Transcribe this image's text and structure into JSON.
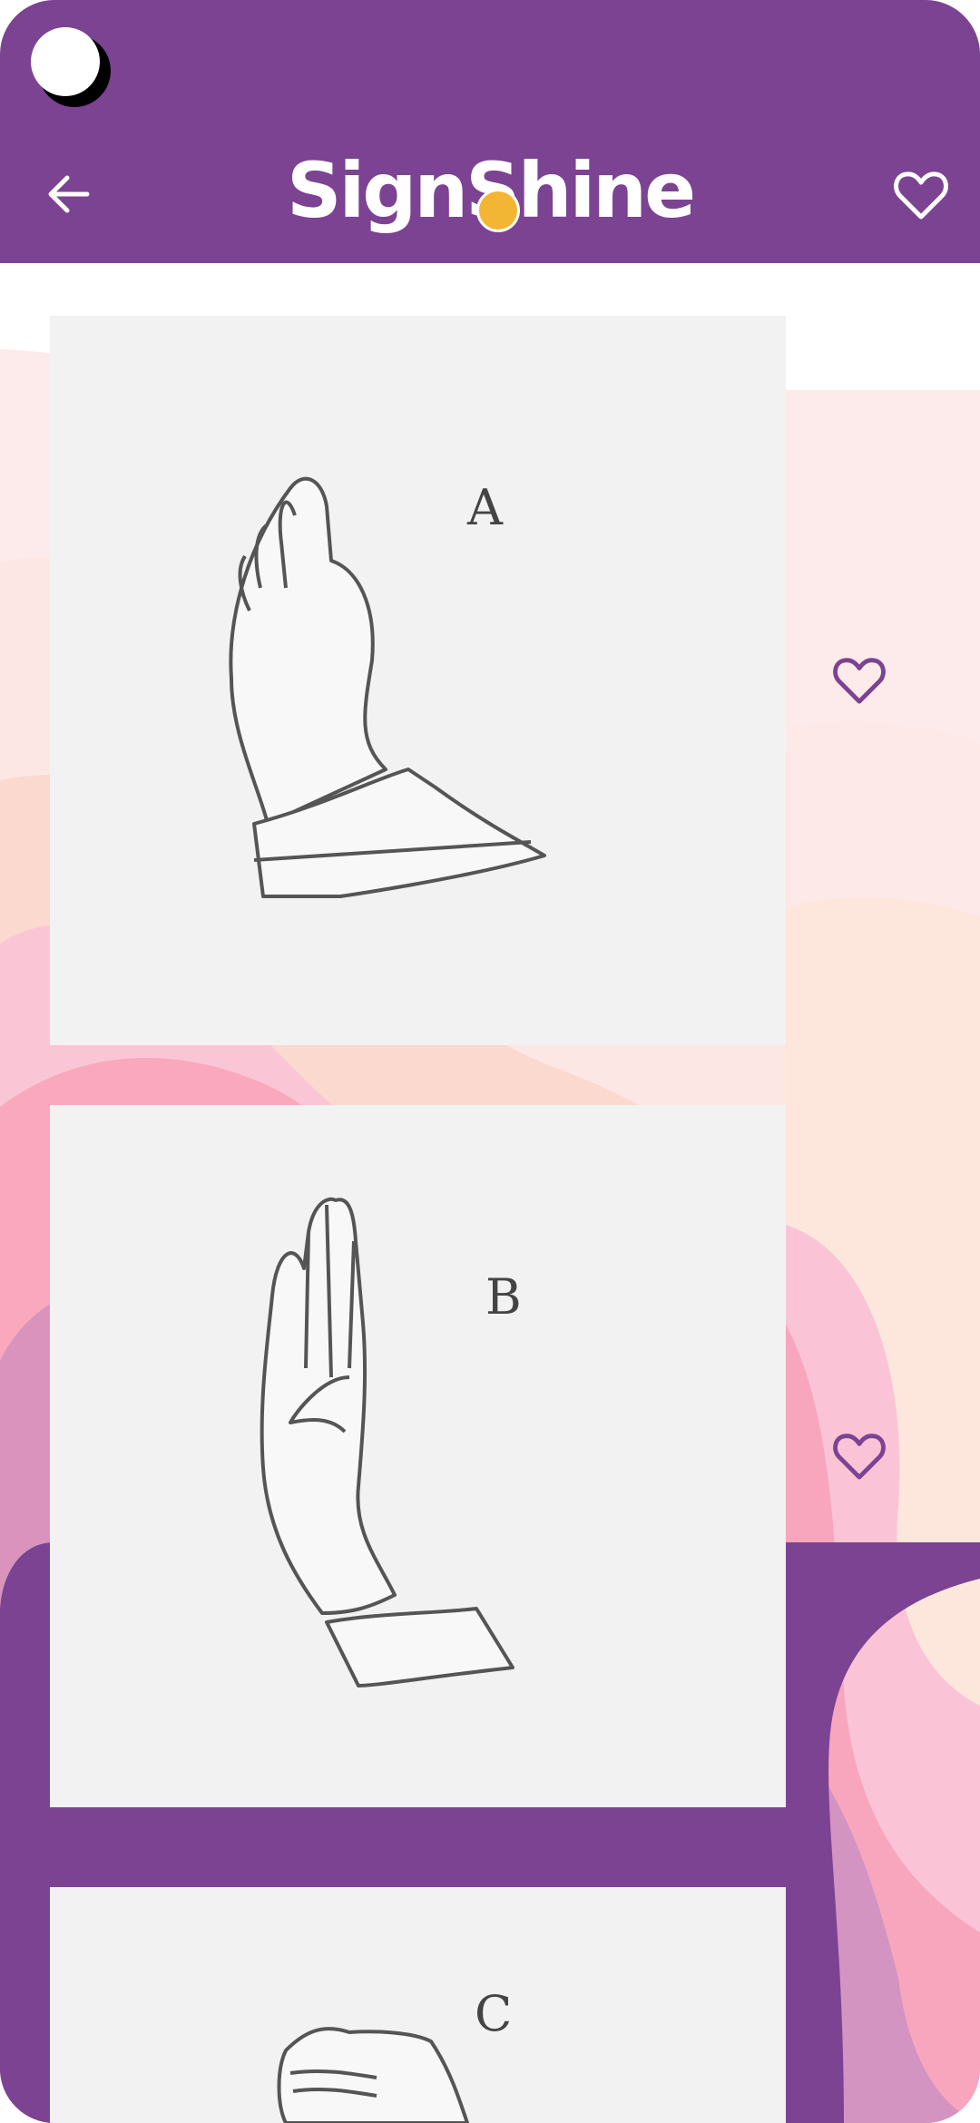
{
  "app": {
    "logo_text": "SignShine",
    "colors": {
      "primary": "#7b4392",
      "card": "#f2f2f2",
      "white": "#ffffff"
    }
  },
  "header": {
    "back_icon": "arrow-left-icon",
    "favorite_icon": "heart-outline-icon"
  },
  "signs": [
    {
      "letter": "A",
      "favorite_icon": "heart-outline-icon"
    },
    {
      "letter": "B",
      "favorite_icon": "heart-outline-icon"
    },
    {
      "letter": "C",
      "favorite_icon": "heart-outline-icon"
    }
  ]
}
